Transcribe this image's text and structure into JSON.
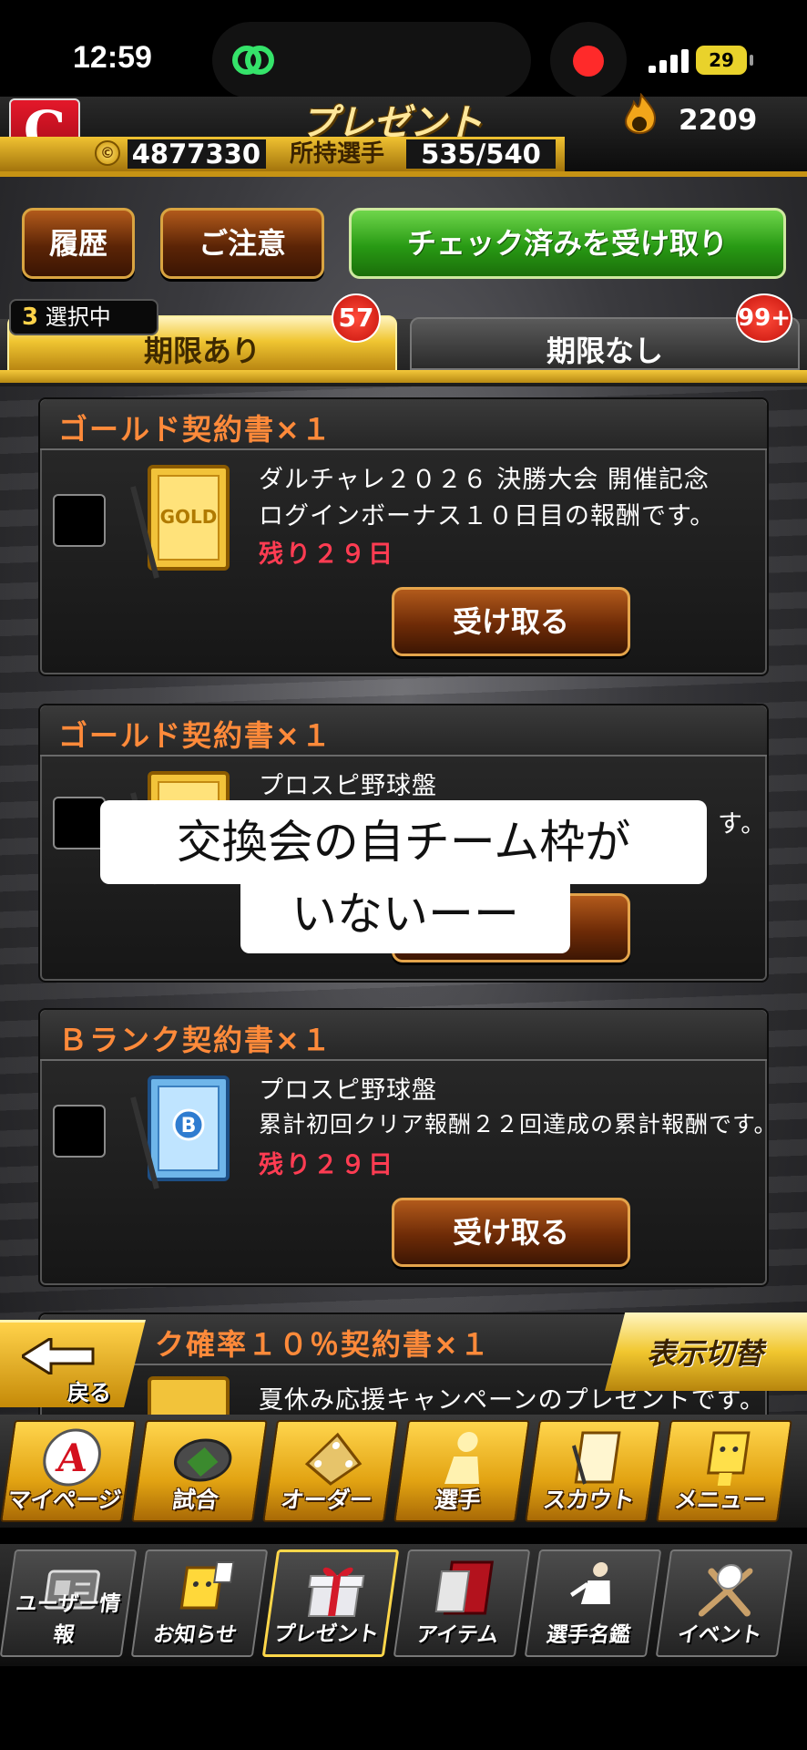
{
  "status_bar": {
    "time": "12:59",
    "battery": "29"
  },
  "header": {
    "title": "プレゼント",
    "gems": "2209",
    "money": "4877330",
    "players_label": "所持選手",
    "players": "535/540"
  },
  "buttons": {
    "history": "履歴",
    "notice": "ご注意",
    "receive_checked": "チェック済みを受け取り"
  },
  "tabs": [
    {
      "label": "期限あり",
      "badge": "57"
    },
    {
      "label": "期限なし",
      "badge": "99+"
    }
  ],
  "selection": {
    "count": "3",
    "label": "選択中"
  },
  "items": [
    {
      "title": "ゴールド契約書×１",
      "line1": "ダルチャレ２０２６ 決勝大会 開催記念",
      "line2": "ログインボーナス１０日目の報酬です。",
      "remaining": "残り２９日",
      "button": "受け取る"
    },
    {
      "title": "ゴールド契約書×１",
      "line1": "プロスピ野球盤",
      "line2": "す。",
      "button": ""
    },
    {
      "title": "Ｂランク契約書×１",
      "line1": "プロスピ野球盤",
      "line2": "累計初回クリア報酬２２回達成の累計報酬です。",
      "remaining": "残り２９日",
      "button": "受け取る"
    },
    {
      "title": "ク確率１０％契約書×１",
      "line1": "夏休み応援キャンペーンのプレゼントです。"
    }
  ],
  "caption": {
    "line1": "交換会の自チーム枠が",
    "line2": "いないーー"
  },
  "back": "戻る",
  "toggle_view": "表示切替",
  "main_nav": [
    "マイページ",
    "試合",
    "オーダー",
    "選手",
    "スカウト",
    "メニュー"
  ],
  "sub_nav": [
    "ユーザー情報",
    "お知らせ",
    "プレゼント",
    "アイテム",
    "選手名鑑",
    "イベント"
  ],
  "colors": {
    "gold": "#f0c632",
    "remain_red": "#ff3c52",
    "title_orange": "#ff8a3a",
    "green_button": "#289a14"
  }
}
